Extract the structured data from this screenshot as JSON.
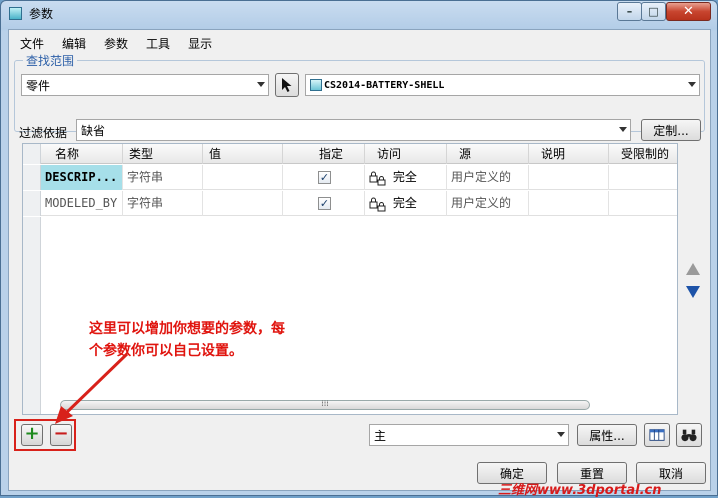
{
  "window": {
    "title": "参数",
    "controls": {
      "minimize": "–",
      "maximize": "□",
      "close": "✕"
    }
  },
  "menu": [
    "文件",
    "编辑",
    "参数",
    "工具",
    "显示"
  ],
  "lookup": {
    "group_title": "查找范围",
    "type_value": "零件",
    "model_value": "CS2014-BATTERY-SHELL"
  },
  "filter": {
    "label": "过滤依据",
    "value": "缺省",
    "customize_label": "定制..."
  },
  "table": {
    "columns": [
      "名称",
      "类型",
      "值",
      "指定",
      "访问",
      "源",
      "说明",
      "受限制的"
    ],
    "rows": [
      {
        "name": "DESCRIP...",
        "type": "字符串",
        "value": "",
        "designated": true,
        "access": "完全",
        "source": "用户定义的",
        "description": "",
        "restricted": ""
      },
      {
        "name": "MODELED_BY",
        "type": "字符串",
        "value": "",
        "designated": true,
        "access": "完全",
        "source": "用户定义的",
        "description": "",
        "restricted": ""
      }
    ],
    "scroll_grip": "⁞⁞⁞"
  },
  "annotation": {
    "line1": "这里可以增加你想要的参数，每",
    "line2": "个参数你可以自己设置。"
  },
  "bottom": {
    "add_symbol": "+",
    "remove_symbol": "−",
    "category_value": "主",
    "properties_label": "属性..."
  },
  "footer": {
    "ok_label": "确定",
    "reset_label": "重置",
    "cancel_label": "取消"
  },
  "watermark": "三维网www.3dportal.cn",
  "colors": {
    "annotation_red": "#e0140e",
    "group_title_blue": "#2d60a8",
    "selected_cell": "#a6dfe9",
    "add_green": "#1f8a1f",
    "remove_red": "#c81d1d"
  }
}
